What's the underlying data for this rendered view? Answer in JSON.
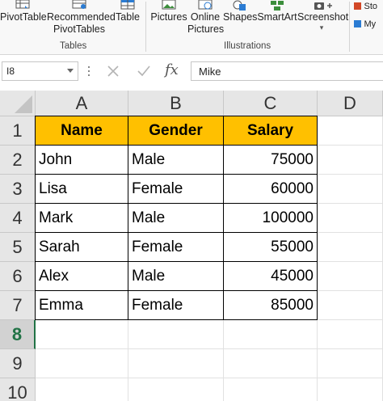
{
  "ribbon": {
    "tables": {
      "pivottable_label": "PivotTable",
      "recommended_line1": "Recommended",
      "recommended_line2": "PivotTables",
      "table_label": "Table",
      "group_label": "Tables"
    },
    "illustrations": {
      "pictures_label": "Pictures",
      "online_line1": "Online",
      "online_line2": "Pictures",
      "shapes_label": "Shapes",
      "smartart_label": "SmartArt",
      "screenshot_label": "Screenshot",
      "group_label": "Illustrations"
    },
    "addins": {
      "store_label": "Sto",
      "my_label": "My"
    },
    "icons": [
      "pivottable-icon",
      "recommended-pivottables-icon",
      "table-icon",
      "pictures-icon",
      "online-pictures-icon",
      "shapes-icon",
      "smartart-icon",
      "screenshot-icon",
      "store-icon",
      "my-addins-icon"
    ]
  },
  "formula_bar": {
    "name_box": "I8",
    "fx_label": "fx",
    "formula": "Mike"
  },
  "sheet": {
    "columns": [
      "A",
      "B",
      "C",
      "D"
    ],
    "row_numbers": [
      "1",
      "2",
      "3",
      "4",
      "5",
      "6",
      "7",
      "8",
      "9",
      "10"
    ],
    "selected_row": "8",
    "table": {
      "headers": [
        "Name",
        "Gender",
        "Salary"
      ],
      "rows": [
        [
          "John",
          "Male",
          "75000"
        ],
        [
          "Lisa",
          "Female",
          "60000"
        ],
        [
          "Mark",
          "Male",
          "100000"
        ],
        [
          "Sarah",
          "Female",
          "55000"
        ],
        [
          "Alex",
          "Male",
          "45000"
        ],
        [
          "Emma",
          "Female",
          "85000"
        ]
      ]
    }
  },
  "colors": {
    "header_fill": "#ffc000",
    "accent_green": "#217346",
    "header_bg": "#e6e6e6"
  }
}
